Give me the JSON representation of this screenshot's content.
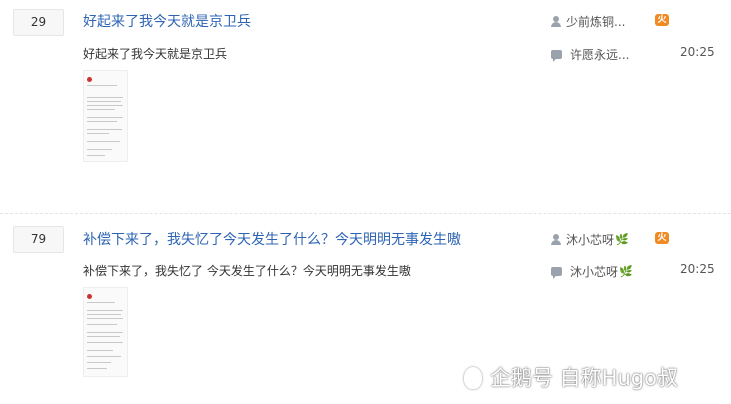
{
  "threads": [
    {
      "reply_count": "29",
      "title": "好起来了我今天就是京卫兵",
      "abstract": "好起来了我今天就是京卫兵",
      "author": "少前炼铜...",
      "author_has_leaf": false,
      "last_reply_author": "许愿永远...",
      "last_reply_has_leaf": false,
      "last_reply_time": "20:25",
      "badge_icon": "fire-badge-icon"
    },
    {
      "reply_count": "79",
      "title": "补偿下来了，我失忆了今天发生了什么？今天明明无事发生嗷",
      "abstract": "补偿下来了，我失忆了 今天发生了什么？今天明明无事发生嗷",
      "author": "沐小芯呀",
      "author_has_leaf": true,
      "last_reply_author": "沐小芯呀",
      "last_reply_has_leaf": true,
      "last_reply_time": "20:25",
      "badge_icon": "fire-badge-icon"
    }
  ],
  "leaf_glyph": "🌿",
  "watermark": {
    "text": "企鹅号 自称Hugo叔"
  },
  "colors": {
    "title_link": "#2d64b3",
    "badge": "#f08a24",
    "icon_gray": "#9aa3ad"
  }
}
